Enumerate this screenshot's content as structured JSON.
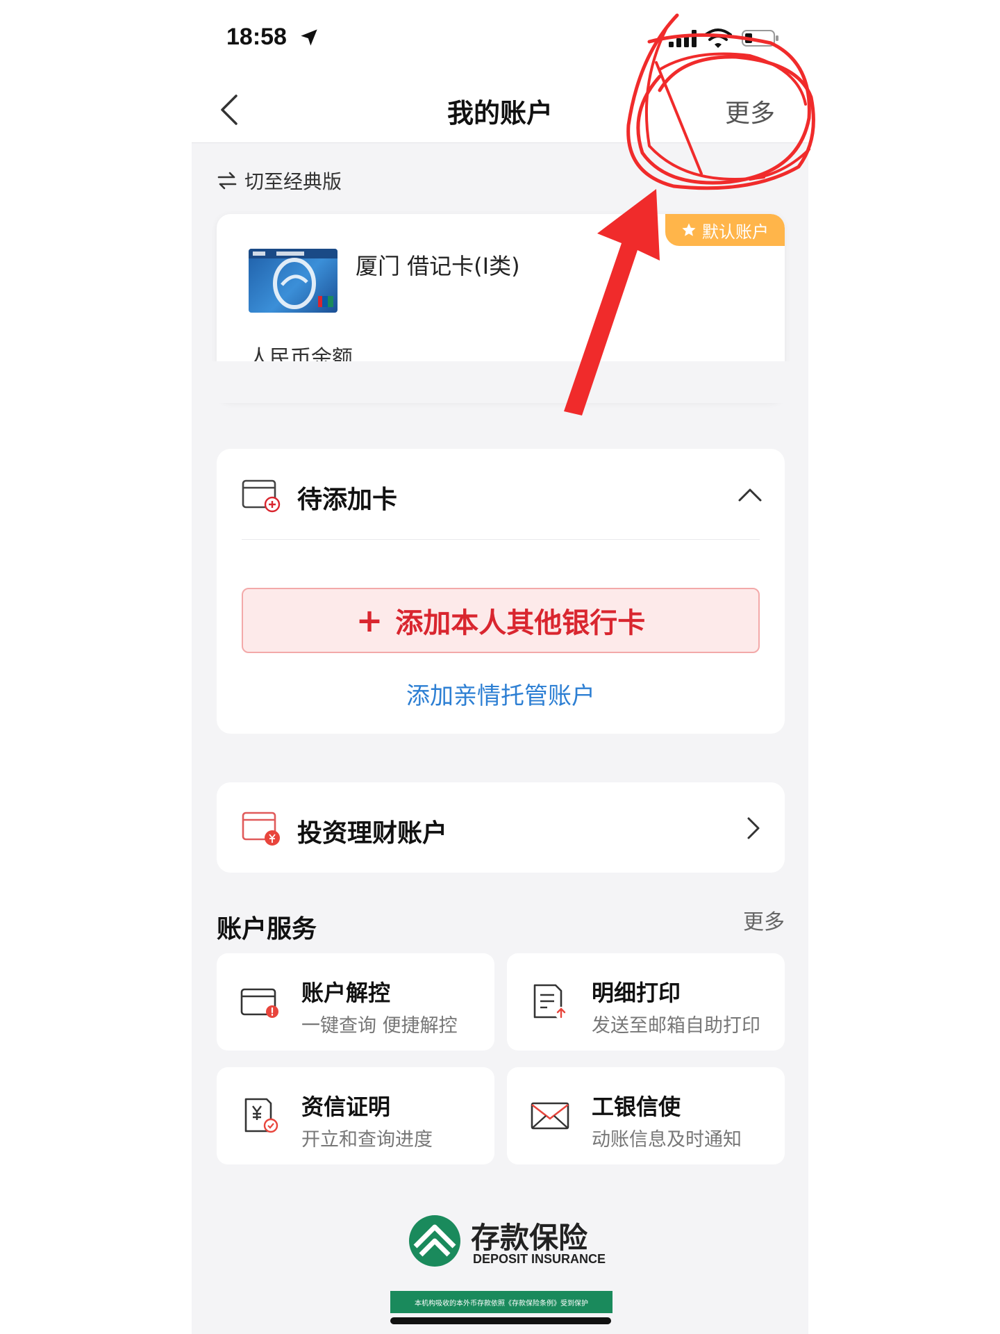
{
  "status_bar": {
    "time": "18:58"
  },
  "nav": {
    "title": "我的账户",
    "more": "更多"
  },
  "switch_label": "切至经典版",
  "account_card": {
    "badge": "默认账户",
    "name": "厦门 借记卡(Ⅰ类)",
    "balance_label": "人民币余额"
  },
  "pending": {
    "title": "待添加卡",
    "add_button": "添加本人其他银行卡",
    "add_plus": "+",
    "family_link": "添加亲情托管账户"
  },
  "invest": {
    "title": "投资理财账户"
  },
  "services": {
    "title": "账户服务",
    "more": "更多",
    "items": [
      {
        "name": "账户解控",
        "desc": "一键查询 便捷解控",
        "icon": "card-alert-icon"
      },
      {
        "name": "明细打印",
        "desc": "发送至邮箱自助打印",
        "icon": "document-print-icon"
      },
      {
        "name": "资信证明",
        "desc": "开立和查询进度",
        "icon": "credit-certificate-icon"
      },
      {
        "name": "工银信使",
        "desc": "动账信息及时通知",
        "icon": "envelope-icon"
      }
    ]
  },
  "footer": {
    "cn": "存款保险",
    "en": "DEPOSIT INSURANCE",
    "notice": "本机构吸收的本外币存款依照《存款保险条例》受到保护"
  },
  "colors": {
    "accent_red": "#d9262f",
    "link_blue": "#2d7fd3",
    "badge_orange": "#ffb54a",
    "footer_green": "#1a8a5c",
    "annotation_red": "#f02b2b"
  }
}
